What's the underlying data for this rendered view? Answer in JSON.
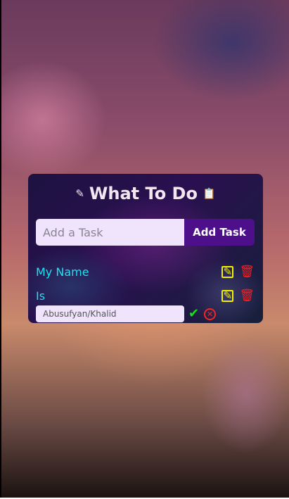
{
  "app": {
    "title": "What To Do",
    "title_icon_left": "pencil-icon",
    "title_icon_right": "clipboard-icon"
  },
  "add_task": {
    "placeholder": "Add a Task",
    "button_label": "Add Task"
  },
  "tasks": [
    {
      "text": "My Name"
    },
    {
      "text": "Is"
    }
  ],
  "edit": {
    "value": "Abusufyan/Khalid"
  },
  "icons": {
    "edit": "edit-icon",
    "delete": "trash-icon",
    "confirm": "check-icon",
    "cancel": "x-circle-icon"
  },
  "colors": {
    "title": "#f3e6f0",
    "task_text": "#22e0f0",
    "edit_icon": "#f0f000",
    "delete_icon": "#ff1c1c",
    "confirm_icon": "#18e018",
    "cancel_icon": "#ff2020",
    "button_bg": "#4d0f8a",
    "input_bg": "#efe4fb"
  }
}
